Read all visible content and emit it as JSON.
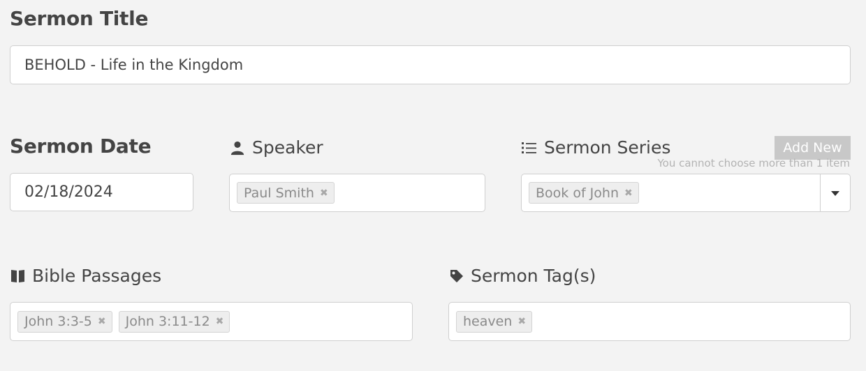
{
  "sermon_title": {
    "heading": "Sermon Title",
    "value": "BEHOLD - Life in the Kingdom"
  },
  "sermon_date": {
    "heading": "Sermon Date",
    "value": "02/18/2024"
  },
  "speaker": {
    "label": "Speaker",
    "icon": "person-icon",
    "tags": [
      {
        "label": "Paul Smith"
      }
    ]
  },
  "sermon_series": {
    "label": "Sermon Series",
    "icon": "list-icon",
    "add_new_label": "Add New",
    "limit_note": "You cannot choose more than 1 item",
    "tags": [
      {
        "label": "Book of John"
      }
    ]
  },
  "bible_passages": {
    "label": "Bible Passages",
    "icon": "book-icon",
    "tags": [
      {
        "label": "John 3:3-5"
      },
      {
        "label": "John 3:11-12"
      }
    ]
  },
  "sermon_tags": {
    "label": "Sermon Tag(s)",
    "icon": "tag-icon",
    "tags": [
      {
        "label": "heaven"
      }
    ]
  },
  "tag_remove_glyph": "✖",
  "colors": {
    "background": "#f3f3f3",
    "text": "#444444",
    "border": "#cfcfcf",
    "chip_bg": "#eeeeee",
    "chip_text": "#8a8a8a",
    "add_new_bg": "#c8c8c8"
  }
}
